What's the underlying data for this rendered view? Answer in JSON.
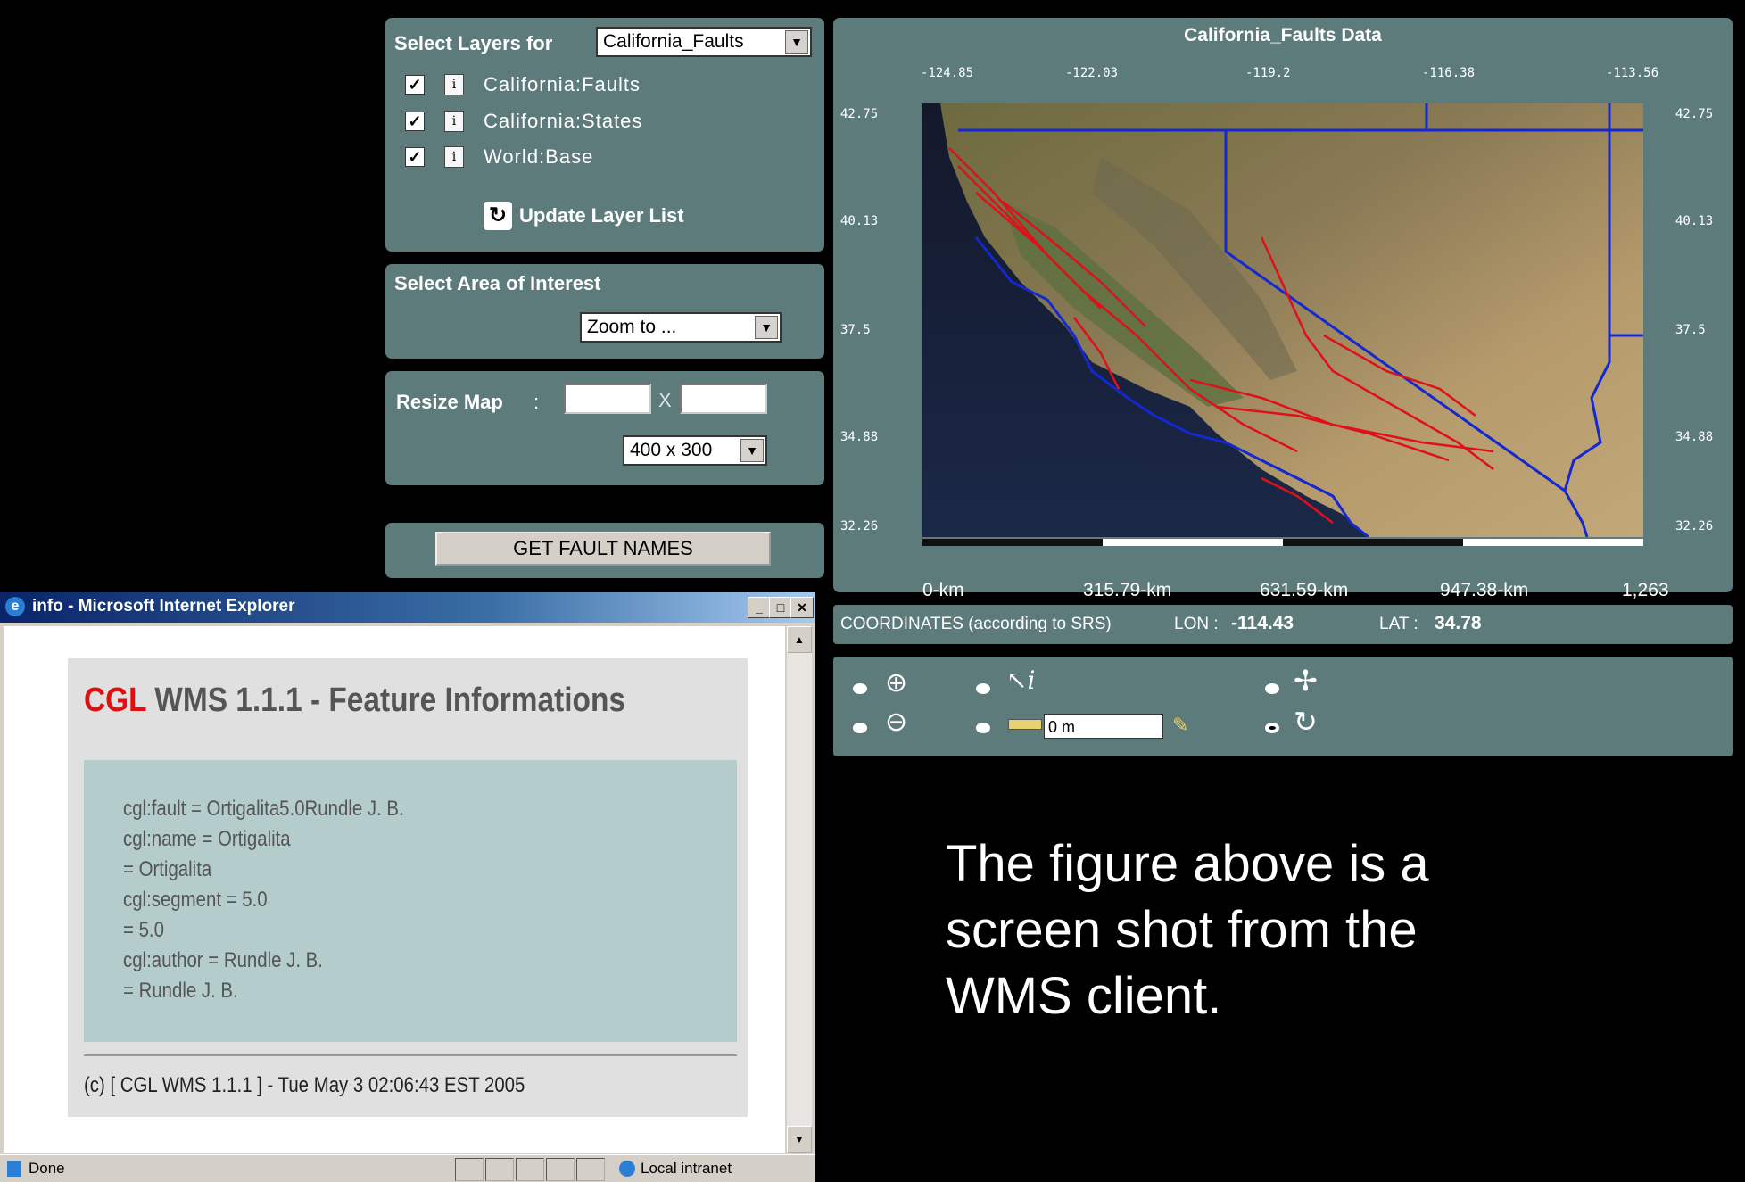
{
  "layers_panel": {
    "title": "Select Layers for",
    "selected_dataset": "California_Faults",
    "layers": [
      {
        "name": "California:Faults",
        "checked": true
      },
      {
        "name": "California:States",
        "checked": true
      },
      {
        "name": "World:Base",
        "checked": true
      }
    ],
    "update_label": "Update Layer List"
  },
  "area_panel": {
    "title": "Select Area of Interest",
    "zoom_select": "Zoom to ..."
  },
  "resize_panel": {
    "label": "Resize Map",
    "colon": ":",
    "x_sep": "X",
    "size_select": "400 x 300"
  },
  "fault_button": "GET FAULT NAMES",
  "map": {
    "title": "California_Faults Data",
    "lon_ticks": [
      "-124.85",
      "-122.03",
      "-119.2",
      "-116.38",
      "-113.56"
    ],
    "lat_ticks": [
      "42.75",
      "40.13",
      "37.5",
      "34.88",
      "32.26"
    ],
    "scale_labels": [
      "0-km",
      "315.79-km",
      "631.59-km",
      "947.38-km",
      "1,263"
    ],
    "colors": {
      "fault": "#e0101a",
      "state_border": "#1428d0"
    }
  },
  "coords": {
    "label": "COORDINATES (according to SRS)",
    "lon_label": "LON :",
    "lon_value": "-114.43",
    "lat_label": "LAT :",
    "lat_value": "34.78"
  },
  "tools": {
    "measure_value": "0 m"
  },
  "ie_window": {
    "title": "info - Microsoft Internet Explorer",
    "heading_brand": "CGL",
    "heading_rest": " WMS 1.1.1 - Feature Informations",
    "lines": [
      "cgl:fault = Ortigalita5.0Rundle J. B.",
      "cgl:name = Ortigalita",
      "= Ortigalita",
      "cgl:segment = 5.0",
      "= 5.0",
      "cgl:author = Rundle J. B.",
      "= Rundle J. B."
    ],
    "footer": "(c) [ CGL WMS 1.1.1 ] - Tue May 3 02:06:43 EST 2005",
    "status_left": "Done",
    "status_right": "Local intranet"
  },
  "caption": [
    "The figure above is a",
    "screen shot from the",
    "WMS client."
  ]
}
